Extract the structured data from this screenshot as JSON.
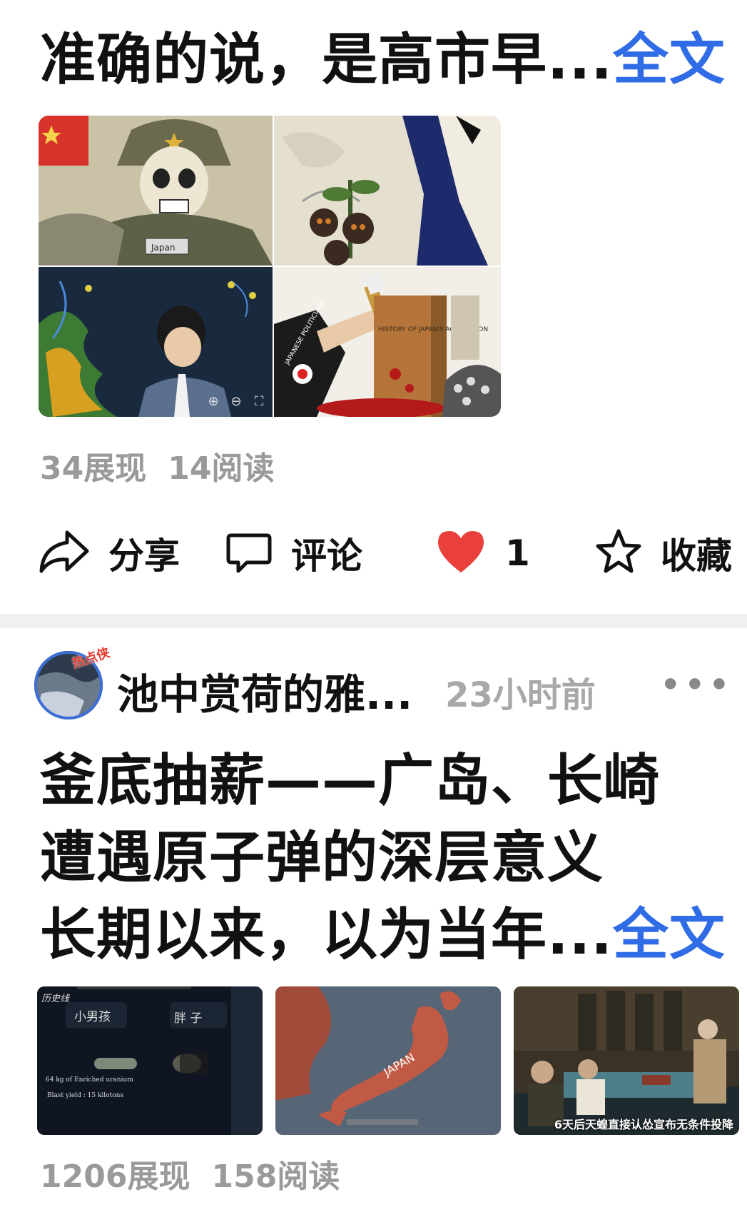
{
  "post1": {
    "title_text": "准确的说，是高市早...",
    "full_text_link": "全文",
    "image_grid": {
      "panel_tag_bottom_left": "Japan",
      "panel_book_title": "HISTORY OF JAPAN'S AGGRESSION",
      "panel_sleeve_text": "JAPANESE POLITICIANS"
    },
    "stats": {
      "impressions": "34展现",
      "reads": "14阅读"
    },
    "actions": {
      "share": "分享",
      "comment": "评论",
      "like_count": "1",
      "favorite": "收藏"
    }
  },
  "post2": {
    "author": {
      "name": "池中赏荷的雅...",
      "badge": "热点侠",
      "time": "23小时前"
    },
    "more_icon": "more-dots-icon",
    "title_lines": [
      "釜底抽薪——广岛、长崎",
      "遭遇原子弹的深层意义",
      "长期以来，以为当年..."
    ],
    "full_text_link": "全文",
    "images": {
      "img1": {
        "corner_tag": "历史线",
        "left_label": "小男孩",
        "right_label": "胖 子",
        "line1": "64 kg of Enriched uranium",
        "line2": "Blast yield : 15 kilotons"
      },
      "img2": {
        "map_label": "JAPAN"
      },
      "img3": {
        "caption": "6天后天蝗直接认怂宣布无条件投降"
      }
    },
    "stats": {
      "impressions": "1206展现",
      "reads": "158阅读"
    }
  },
  "colors": {
    "link_blue": "#2f6ce5",
    "like_red": "#e9403b",
    "muted_gray": "#9a9a9a"
  }
}
